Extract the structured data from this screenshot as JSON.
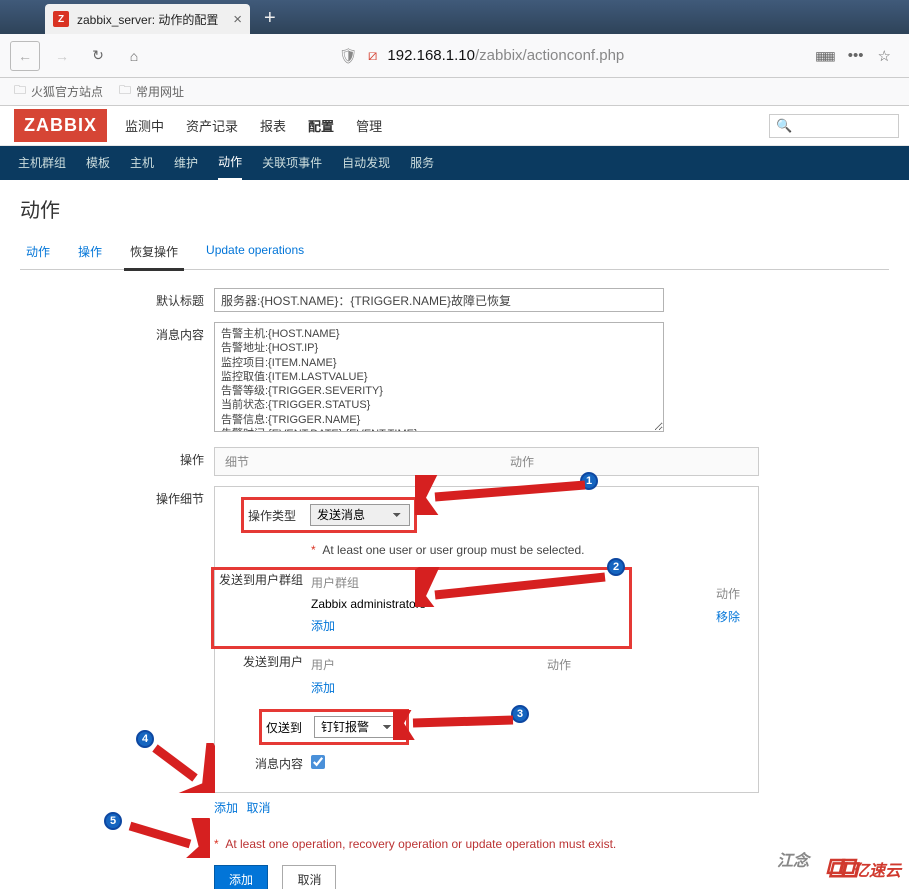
{
  "browser": {
    "tab_title": "zabbix_server: 动作的配置",
    "tab_favicon": "Z",
    "url_host": "192.168.1.10",
    "url_path": "/zabbix/actionconf.php",
    "bookmarks": [
      "火狐官方站点",
      "常用网址"
    ]
  },
  "logo": "ZABBIX",
  "topnav": {
    "items": [
      "监测中",
      "资产记录",
      "报表",
      "配置",
      "管理"
    ],
    "active": "配置"
  },
  "subnav": {
    "items": [
      "主机群组",
      "模板",
      "主机",
      "维护",
      "动作",
      "关联项事件",
      "自动发现",
      "服务"
    ],
    "active": "动作"
  },
  "page": {
    "title": "动作",
    "tabs": [
      "动作",
      "操作",
      "恢复操作",
      "Update operations"
    ],
    "active_tab": "恢复操作"
  },
  "form": {
    "default_title_label": "默认标题",
    "default_title_value": "服务器:{HOST.NAME}：{TRIGGER.NAME}故障已恢复",
    "msg_content_label": "消息内容",
    "msg_content_value": "告警主机:{HOST.NAME}\n告警地址:{HOST.IP}\n监控项目:{ITEM.NAME}\n监控取值:{ITEM.LASTVALUE}\n告警等级:{TRIGGER.SEVERITY}\n当前状态:{TRIGGER.STATUS}\n告警信息:{TRIGGER.NAME}\n告警时间:{EVENT.DATE} {EVENT.TIME}",
    "ops_label": "操作",
    "ops_col_details": "细节",
    "ops_col_action": "动作",
    "details_label": "操作细节",
    "op_type_label": "操作类型",
    "op_type_value": "发送消息",
    "op_warning": "At least one user or user group must be selected.",
    "send_to_group_label": "发送到用户群组",
    "user_group_col": "用户群组",
    "action_col": "动作",
    "group_name": "Zabbix administrators",
    "remove_link": "移除",
    "add_link": "添加",
    "send_to_user_label": "发送到用户",
    "user_col": "用户",
    "only_send_to_label": "仅送到",
    "only_send_to_value": "钉钉报警",
    "msg_content2_label": "消息内容",
    "add_btn": "添加",
    "cancel_btn": "取消",
    "bottom_warning": "At least one operation, recovery operation or update operation must exist.",
    "submit_add": "添加",
    "submit_cancel": "取消"
  },
  "watermark": {
    "sig": "江念",
    "brand": "亿速云"
  }
}
